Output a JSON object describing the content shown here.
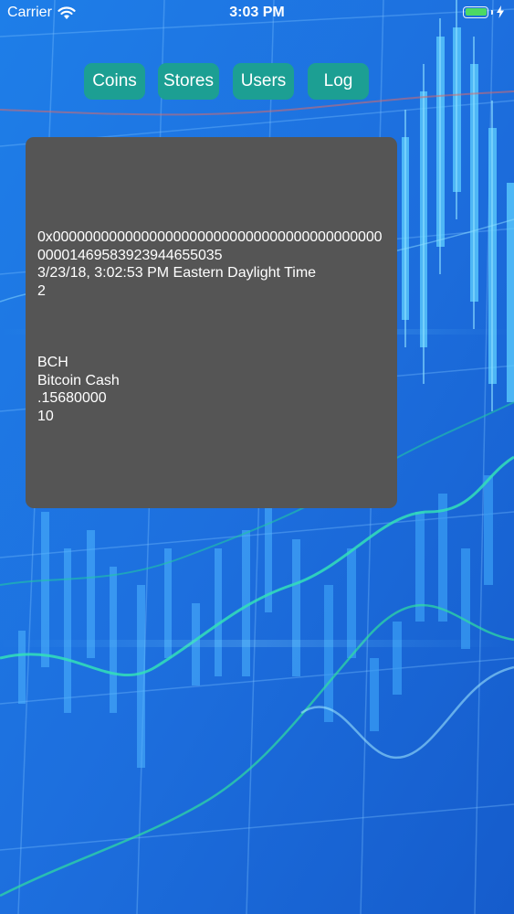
{
  "status_bar": {
    "carrier": "Carrier",
    "time": "3:03 PM",
    "battery_color": "#4cd964"
  },
  "nav": {
    "coins": "Coins",
    "stores": "Stores",
    "users": "Users",
    "log": "Log",
    "button_color": "#1c9f93"
  },
  "record": {
    "hash": "0x0000000000000000000000000000000000000000000001469583923944655035",
    "timestamp": "3/23/18, 3:02:53 PM Eastern Daylight Time",
    "count": "2"
  },
  "coin": {
    "symbol": "BCH",
    "name": "Bitcoin Cash",
    "amount": ".15680000",
    "quantity": "10"
  },
  "icons": [
    "wifi-icon",
    "battery-icon",
    "charging-bolt-icon"
  ]
}
